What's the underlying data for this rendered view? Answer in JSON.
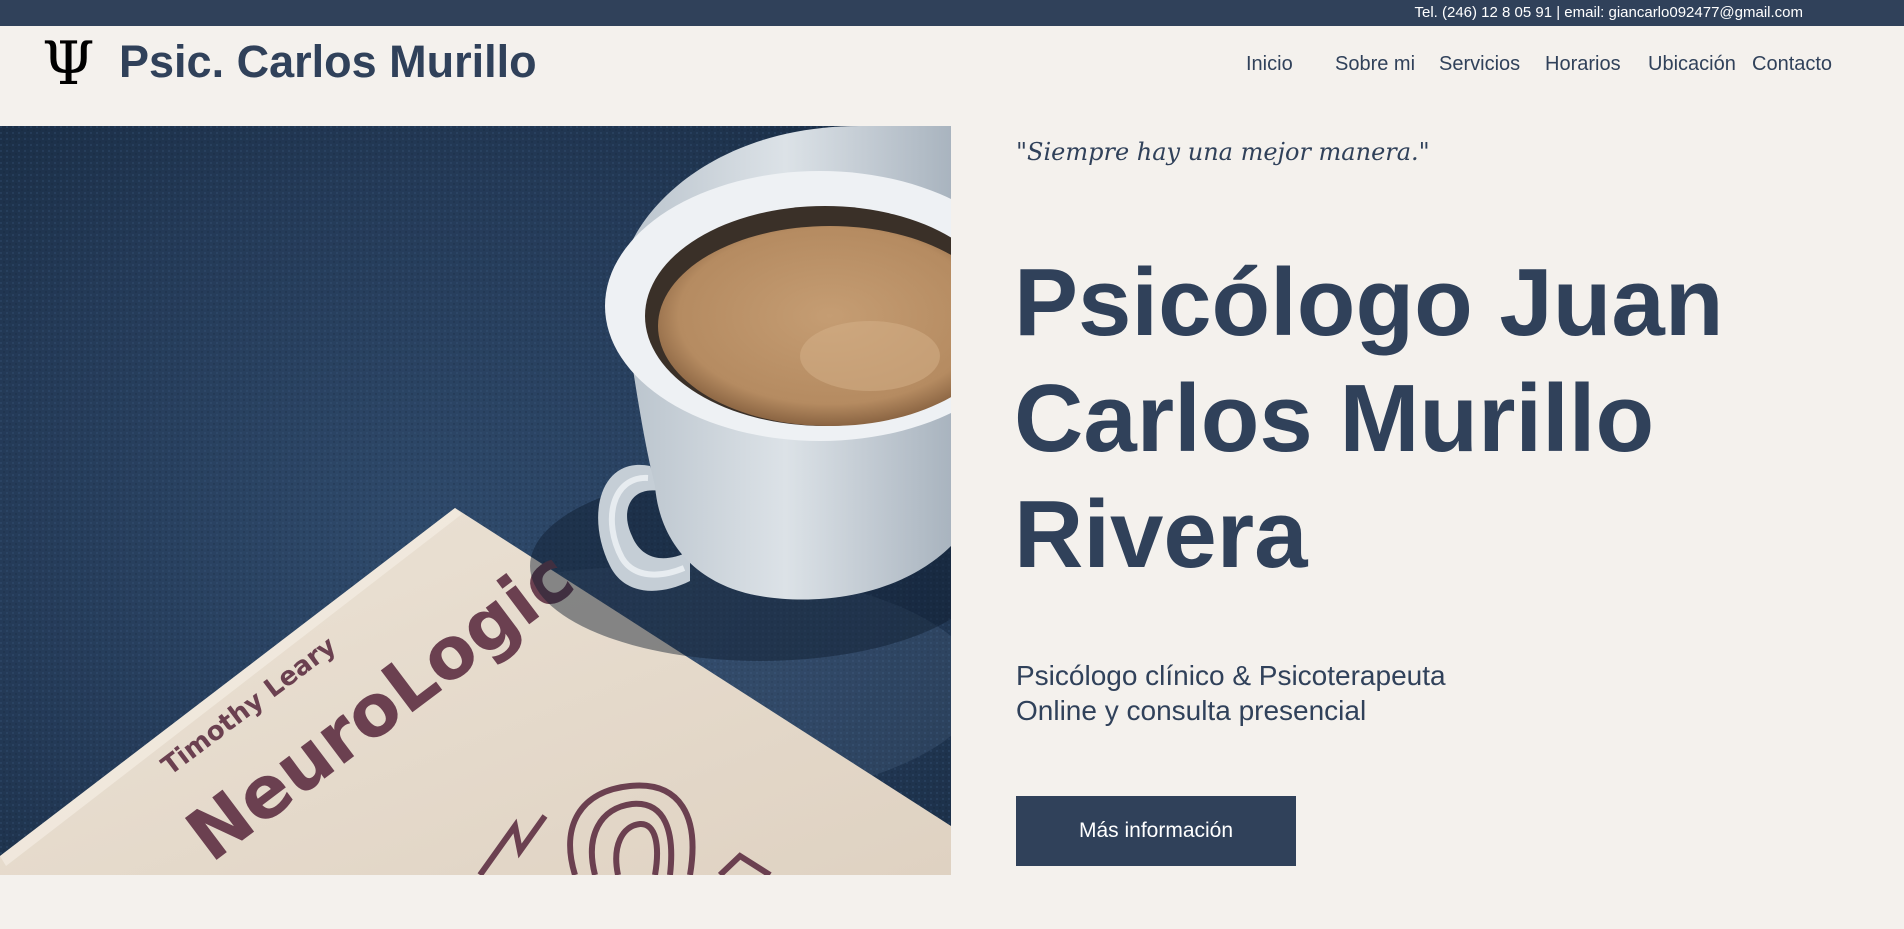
{
  "topbar": {
    "contact": "Tel. (246) 12 8 05 91 | email: giancarlo092477@gmail.com"
  },
  "header": {
    "logo_symbol": "Ψ",
    "brand": "Psic. Carlos Murillo",
    "nav": [
      {
        "label": "Inicio"
      },
      {
        "label": "Sobre mi"
      },
      {
        "label": "Servicios"
      },
      {
        "label": "Horarios"
      },
      {
        "label": "Ubicación"
      },
      {
        "label": "Contacto"
      }
    ]
  },
  "hero": {
    "image": {
      "book_author": "Timothy Leary",
      "book_title": "NeuroLogic"
    },
    "quote": "\"Siempre hay una mejor manera.\"",
    "title_lines": [
      "Psicólogo Juan",
      "Carlos Murillo",
      "Rivera"
    ],
    "subtitle_lines": [
      "Psicólogo clínico & Psicoterapeuta",
      "Online y consulta presencial"
    ],
    "cta_label": "Más información"
  },
  "colors": {
    "primary": "#30415a",
    "background": "#f4f1ed",
    "topbar_text": "#ffffff"
  }
}
